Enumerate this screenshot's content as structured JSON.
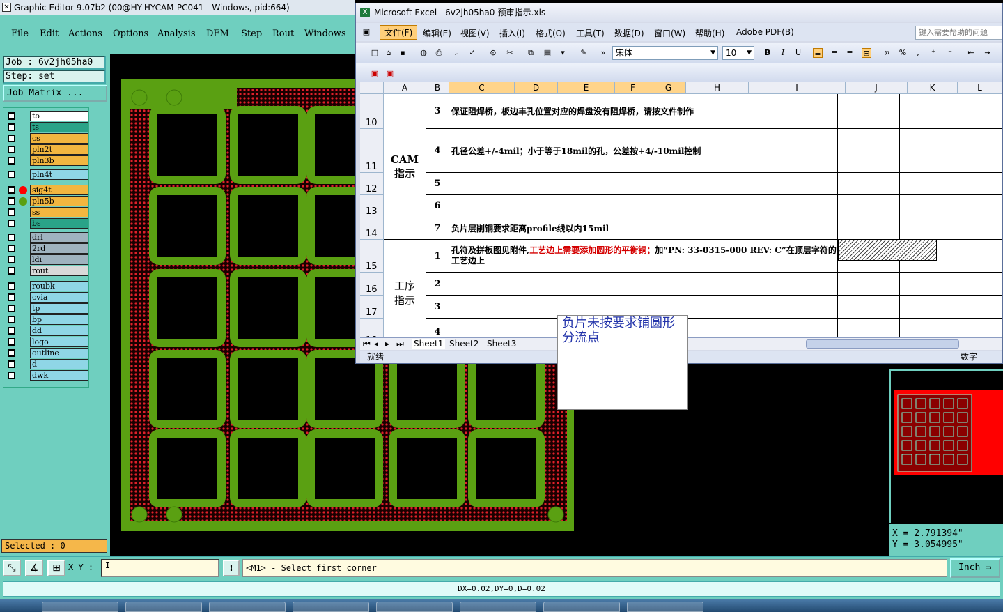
{
  "ge": {
    "title": "Graphic Editor 9.07b2 (00@HY-HYCAM-PC041 - Windows, pid:664)",
    "menu": [
      {
        "label": "File"
      },
      {
        "label": "Edit"
      },
      {
        "label": "Actions"
      },
      {
        "label": "Options"
      },
      {
        "label": "Analysis"
      },
      {
        "label": "DFM"
      },
      {
        "label": "Step"
      },
      {
        "label": "Rout"
      },
      {
        "label": "Windows"
      }
    ],
    "job": "Job : 6v2jh05ha0",
    "step": "Step: set",
    "job_matrix": "Job Matrix ...",
    "layers": [
      {
        "name": "to",
        "color": "#ffffff"
      },
      {
        "name": "ts",
        "color": "#2aa388"
      },
      {
        "name": "cs",
        "color": "#f2b640"
      },
      {
        "name": "pln2t",
        "color": "#f2b640"
      },
      {
        "name": "pln3b",
        "color": "#f2b640"
      },
      {
        "name": "pln4t",
        "color": "#8fd6e6"
      },
      {
        "name": "sig4t",
        "color": "#f2b640"
      },
      {
        "name": "pln5b",
        "color": "#f2b640"
      },
      {
        "name": "ss",
        "color": "#f2b640"
      },
      {
        "name": "bs",
        "color": "#2aa388"
      },
      {
        "name": "drl",
        "color": "#9fb3bf"
      },
      {
        "name": "2rd",
        "color": "#9fb3bf"
      },
      {
        "name": "ldi",
        "color": "#9fb3bf"
      },
      {
        "name": "rout",
        "color": "#d9d9d9"
      },
      {
        "name": "roubk",
        "color": "#8fd6e6"
      },
      {
        "name": "cvia",
        "color": "#8fd6e6"
      },
      {
        "name": "tp",
        "color": "#8fd6e6"
      },
      {
        "name": "bp",
        "color": "#8fd6e6"
      },
      {
        "name": "dd",
        "color": "#8fd6e6"
      },
      {
        "name": "logo",
        "color": "#8fd6e6"
      },
      {
        "name": "outline",
        "color": "#8fd6e6"
      },
      {
        "name": "d",
        "color": "#8fd6e6"
      },
      {
        "name": "dwk",
        "color": "#8fd6e6"
      }
    ],
    "selected": "Selected : 0",
    "xy_label": "X Y :",
    "xy_value": "I",
    "prompt": "<M1> - Select first corner",
    "unit": "Inch",
    "status": "DX=0.02,DY=0,D=0.02",
    "coord_x": "X = 2.791394\"",
    "coord_y": "Y = 3.054995\""
  },
  "xl": {
    "title": "Microsoft Excel - 6v2jh05ha0-预审指示.xls",
    "menu": [
      {
        "label": "文件(F)"
      },
      {
        "label": "编辑(E)"
      },
      {
        "label": "视图(V)"
      },
      {
        "label": "插入(I)"
      },
      {
        "label": "格式(O)"
      },
      {
        "label": "工具(T)"
      },
      {
        "label": "数据(D)"
      },
      {
        "label": "窗口(W)"
      },
      {
        "label": "帮助(H)"
      },
      {
        "label": "Adobe PDF(B)"
      }
    ],
    "help_placeholder": "键入需要帮助的问题",
    "font": "宋体",
    "font_size": "10",
    "columns": [
      "A",
      "B",
      "C",
      "D",
      "E",
      "F",
      "G",
      "H",
      "I",
      "J",
      "K",
      "L"
    ],
    "rows": [
      "10",
      "11",
      "12",
      "13",
      "14",
      "15",
      "16",
      "17",
      "18"
    ],
    "group1": "CAM\n指示",
    "group2": "工序\n指示",
    "cells": [
      {
        "n": "3",
        "text": "保证阻焊桥，板边丰孔位置对应的焊盘没有阻焊桥，请按文件制作"
      },
      {
        "n": "4",
        "text": "孔径公差+/-4mil；小于等于18mil的孔，公差按+4/-10mil控制"
      },
      {
        "n": "5",
        "text": ""
      },
      {
        "n": "6",
        "text": ""
      },
      {
        "n": "7",
        "text": "负片层削铜要求距离profile线以内15mil"
      },
      {
        "n": "1",
        "text_a": "孔符及拼板图见附件,",
        "text_red": "工艺边上需要添加圆形的平衡铜；",
        "text_b": "加“PN: 33-0315-000 REV: C”在顶层字符的工艺边上"
      },
      {
        "n": "2",
        "text": ""
      },
      {
        "n": "3",
        "text": ""
      },
      {
        "n": "4",
        "text": ""
      }
    ],
    "sheets": [
      "Sheet1",
      "Sheet2",
      "Sheet3"
    ],
    "status_left": "就绪",
    "status_right": "数字"
  },
  "comment": "负片未按要求铺圆形分流点"
}
